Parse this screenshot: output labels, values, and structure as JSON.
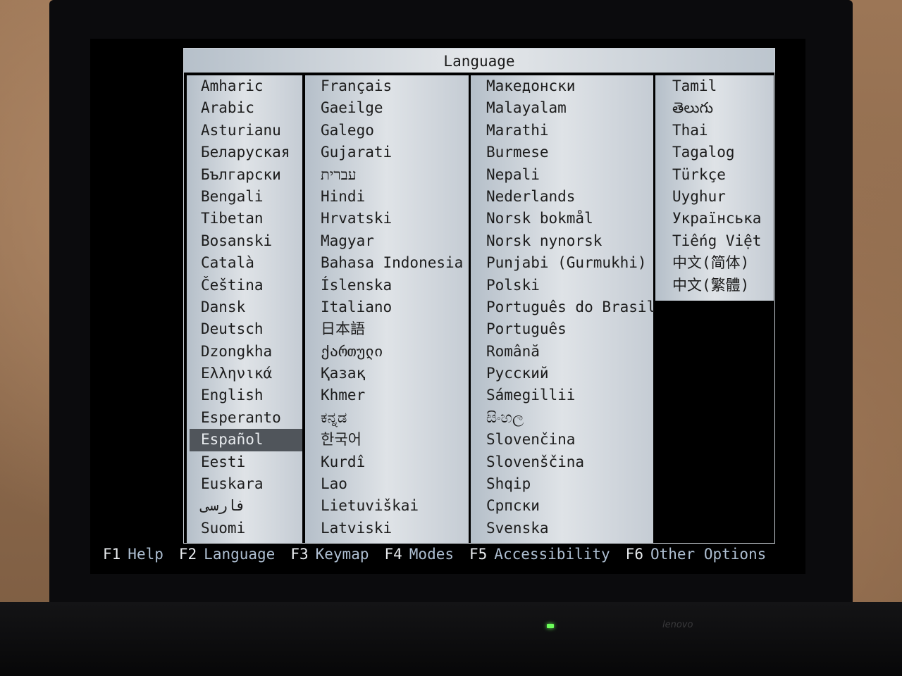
{
  "dialog": {
    "title": "Language"
  },
  "columns": [
    [
      "Amharic",
      "Arabic",
      "Asturianu",
      "Беларуская",
      "Български",
      "Bengali",
      "Tibetan",
      "Bosanski",
      "Català",
      "Čeština",
      "Dansk",
      "Deutsch",
      "Dzongkha",
      "Ελληνικά",
      "English",
      "Esperanto",
      "Español",
      "Eesti",
      "Euskara",
      "فارسی",
      "Suomi"
    ],
    [
      "Français",
      "Gaeilge",
      "Galego",
      "Gujarati",
      "עברית",
      "Hindi",
      "Hrvatski",
      "Magyar",
      "Bahasa Indonesia",
      "Íslenska",
      "Italiano",
      "日本語",
      "ქართული",
      "Қазақ",
      "Khmer",
      "ಕನ್ನಡ",
      "한국어",
      "Kurdî",
      "Lao",
      "Lietuviškai",
      "Latviski"
    ],
    [
      "Македонски",
      "Malayalam",
      "Marathi",
      "Burmese",
      "Nepali",
      "Nederlands",
      "Norsk bokmål",
      "Norsk nynorsk",
      "Punjabi (Gurmukhi)",
      "Polski",
      "Português do Brasil",
      "Português",
      "Română",
      "Русский",
      "Sámegillii",
      "සිංහල",
      "Slovenčina",
      "Slovenščina",
      "Shqip",
      "Српски",
      "Svenska"
    ],
    [
      "Tamil",
      "తెలుగు",
      "Thai",
      "Tagalog",
      "Türkçe",
      "Uyghur",
      "Українська",
      "Tiếng Việt",
      "中文(简体)",
      "中文(繁體)"
    ]
  ],
  "selected": "Español",
  "function_keys": [
    {
      "key": "F1",
      "label": "Help"
    },
    {
      "key": "F2",
      "label": "Language"
    },
    {
      "key": "F3",
      "label": "Keymap"
    },
    {
      "key": "F4",
      "label": "Modes"
    },
    {
      "key": "F5",
      "label": "Accessibility"
    },
    {
      "key": "F6",
      "label": "Other Options"
    }
  ],
  "hardware": {
    "brand": "lenovo",
    "led_color": "#6cff5a"
  }
}
